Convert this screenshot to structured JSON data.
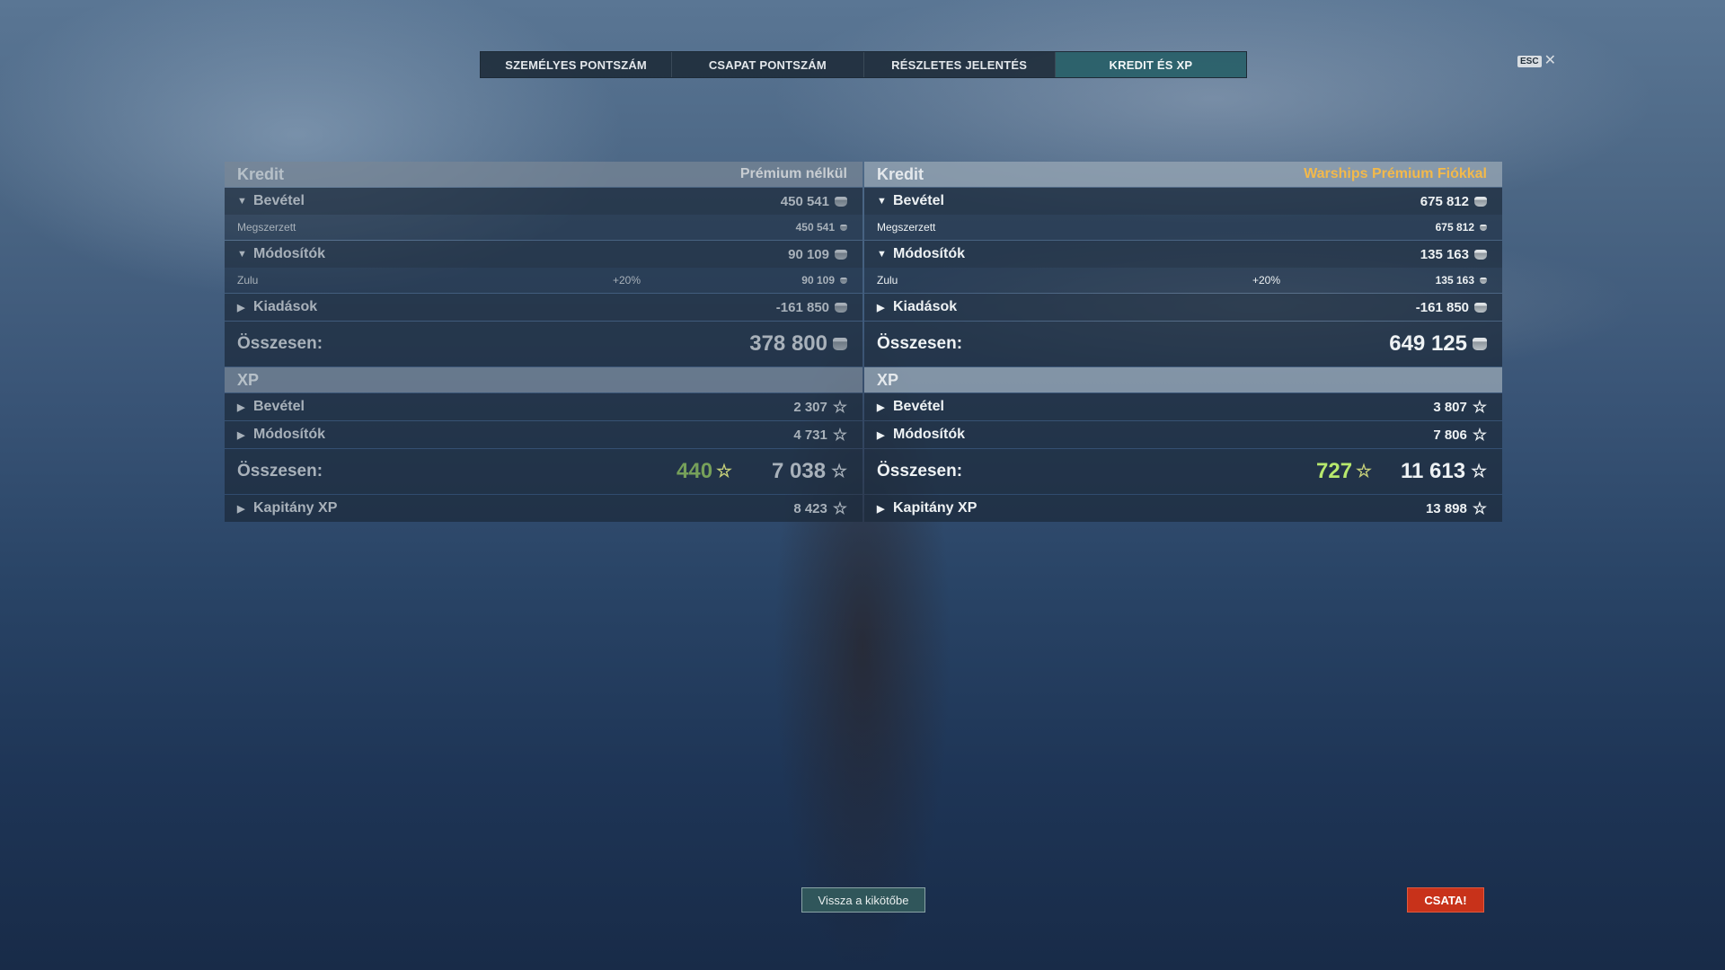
{
  "tabs": [
    {
      "label": "SZEMÉLYES PONTSZÁM"
    },
    {
      "label": "CSAPAT PONTSZÁM"
    },
    {
      "label": "RÉSZLETES JELENTÉS"
    },
    {
      "label": "KREDIT ÉS XP",
      "active": true
    }
  ],
  "esc": {
    "key": "ESC",
    "close": "✕"
  },
  "left": {
    "credit_title": "Kredit",
    "credit_subtitle": "Prémium nélkül",
    "income": {
      "label": "Bevétel",
      "value": "450 541"
    },
    "earned": {
      "label": "Megszerzett",
      "value": "450 541"
    },
    "modifiers": {
      "label": "Módosítók",
      "value": "90 109"
    },
    "zulu": {
      "label": "Zulu",
      "pct": "+20%",
      "value": "90 109"
    },
    "expenses": {
      "label": "Kiadások",
      "value": "-161 850"
    },
    "credit_total": {
      "label": "Összesen:",
      "value": "378 800"
    },
    "xp_title": "XP",
    "xp_income": {
      "label": "Bevétel",
      "value": "2 307"
    },
    "xp_modifiers": {
      "label": "Módosítók",
      "value": "4 731"
    },
    "xp_total": {
      "label": "Összesen:",
      "earned": "440",
      "value": "7 038"
    },
    "captain_xp": {
      "label": "Kapitány XP",
      "value": "8 423"
    }
  },
  "right": {
    "credit_title": "Kredit",
    "credit_subtitle": "Warships Prémium Fiókkal",
    "income": {
      "label": "Bevétel",
      "value": "675 812"
    },
    "earned": {
      "label": "Megszerzett",
      "value": "675 812"
    },
    "modifiers": {
      "label": "Módosítók",
      "value": "135 163"
    },
    "zulu": {
      "label": "Zulu",
      "pct": "+20%",
      "value": "135 163"
    },
    "expenses": {
      "label": "Kiadások",
      "value": "-161 850"
    },
    "credit_total": {
      "label": "Összesen:",
      "value": "649 125"
    },
    "xp_title": "XP",
    "xp_income": {
      "label": "Bevétel",
      "value": "3 807"
    },
    "xp_modifiers": {
      "label": "Módosítók",
      "value": "7 806"
    },
    "xp_total": {
      "label": "Összesen:",
      "earned": "727",
      "value": "11 613"
    },
    "captain_xp": {
      "label": "Kapitány XP",
      "value": "13 898"
    }
  },
  "buttons": {
    "back": "Vissza a kikötőbe",
    "battle": "CSATA!"
  },
  "icons": {
    "credit": "credit-coin-icon",
    "xp": "star-icon",
    "expand": "caret-right-icon",
    "collapse": "caret-down-icon"
  },
  "colors": {
    "premium_accent": "#f3b94a",
    "active_tab": "#286068",
    "battle_button": "#c8321a",
    "earned_xp": "#b7e86d"
  }
}
